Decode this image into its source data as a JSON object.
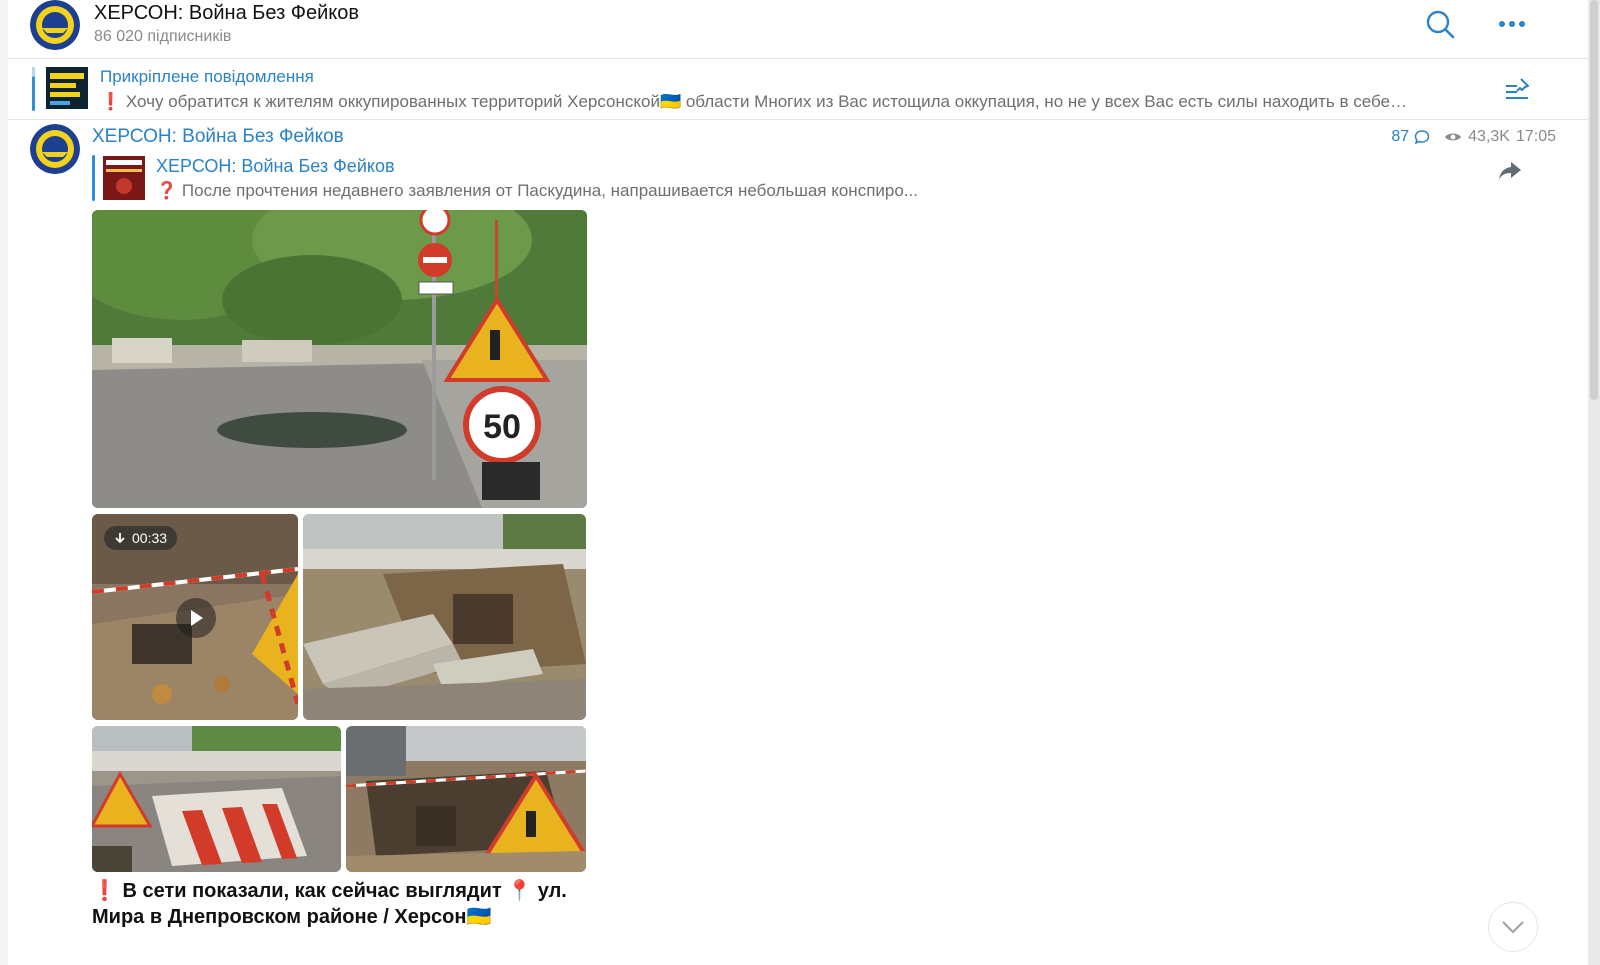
{
  "header": {
    "channel_title": "ХЕРСОН: Война Без Фейков",
    "subscribers": "86 020 підписників",
    "search_icon": "search-icon",
    "menu_icon": "more-horizontal-icon"
  },
  "pinned": {
    "title": "Прикріплене повідомлення",
    "text": "❗️ Хочу обратится к жителям оккупированных территорий Херсонской🇺🇦 области  Многих из Вас истощила оккупация, но не у всех Вас есть силы находить в себе…",
    "thumb_text": "РАЗОМ МИ ЗРОБИМО БІЛЬШЕ",
    "pin_icon": "pin-list-icon"
  },
  "message": {
    "author": "ХЕРСОН: Война Без Фейков",
    "comments": "87",
    "views": "43,3K",
    "time": "17:05",
    "forward_title": "ХЕРСОН: Война Без Фейков",
    "forward_text": "❓ После прочтения недавнего заявления от Паскудина, напрашивается небольшая конспиро...",
    "forward_thumb_text": "ХЕРСОНЬКИЙ",
    "video_duration": "00:33",
    "caption_line1": "❗️ В сети показали, как сейчас выглядит 📍 ул.",
    "caption_line2": "Мира в Днепровском районе / Херсон🇺🇦",
    "share_icon": "share-arrow-icon"
  },
  "colors": {
    "accent": "#2a83c8",
    "muted": "#8a8a8a"
  }
}
